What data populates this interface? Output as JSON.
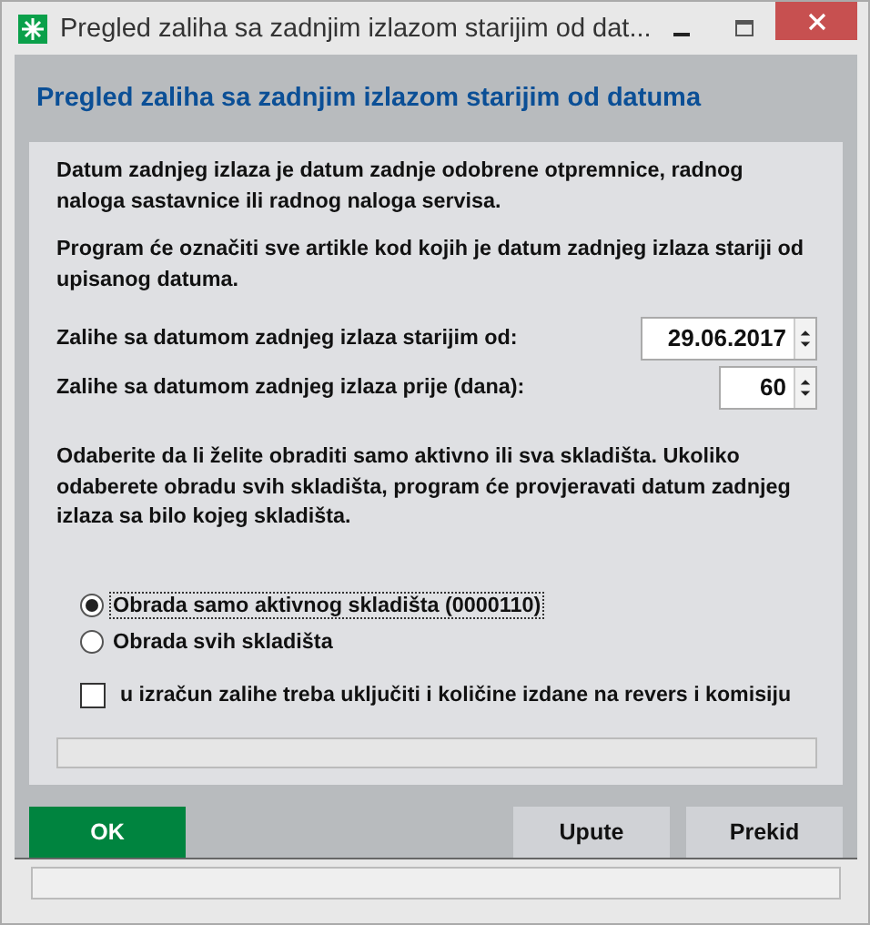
{
  "window": {
    "title": "Pregled zaliha sa zadnjim izlazom starijim od dat..."
  },
  "header": {
    "title": "Pregled zaliha sa zadnjim izlazom starijim od datuma"
  },
  "paragraphs_top": [
    "Datum zadnjeg izlaza je datum zadnje odobrene otpremnice, radnog naloga sastavnice ili radnog naloga servisa.",
    "Program će označiti sve artikle kod kojih je datum zadnjeg izlaza stariji od upisanog datuma."
  ],
  "fields": [
    {
      "label": "Zalihe sa datumom zadnjeg izlaza starijim od:",
      "value": "29.06.2017",
      "kind": "date"
    },
    {
      "label": "Zalihe sa datumom zadnjeg izlaza prije (dana):",
      "value": "60",
      "kind": "number"
    }
  ],
  "paragraph_scope": "Odaberite da li želite obraditi samo aktivno ili sva skladišta. Ukoliko odaberete obradu svih skladišta, program će provjeravati datum zadnjeg izlaza sa bilo kojeg skladišta.",
  "radios": [
    {
      "label": "Obrada samo aktivnog skladišta (0000110)",
      "selected": true
    },
    {
      "label": "Obrada svih skladišta",
      "selected": false
    }
  ],
  "checkbox": {
    "label": "u izračun zalihe treba uključiti i količine izdane na revers i komisiju",
    "checked": false
  },
  "buttons": [
    {
      "label": "OK",
      "kind": "primary"
    },
    {
      "label": "Upute",
      "kind": "normal"
    },
    {
      "label": "Prekid",
      "kind": "normal"
    }
  ]
}
